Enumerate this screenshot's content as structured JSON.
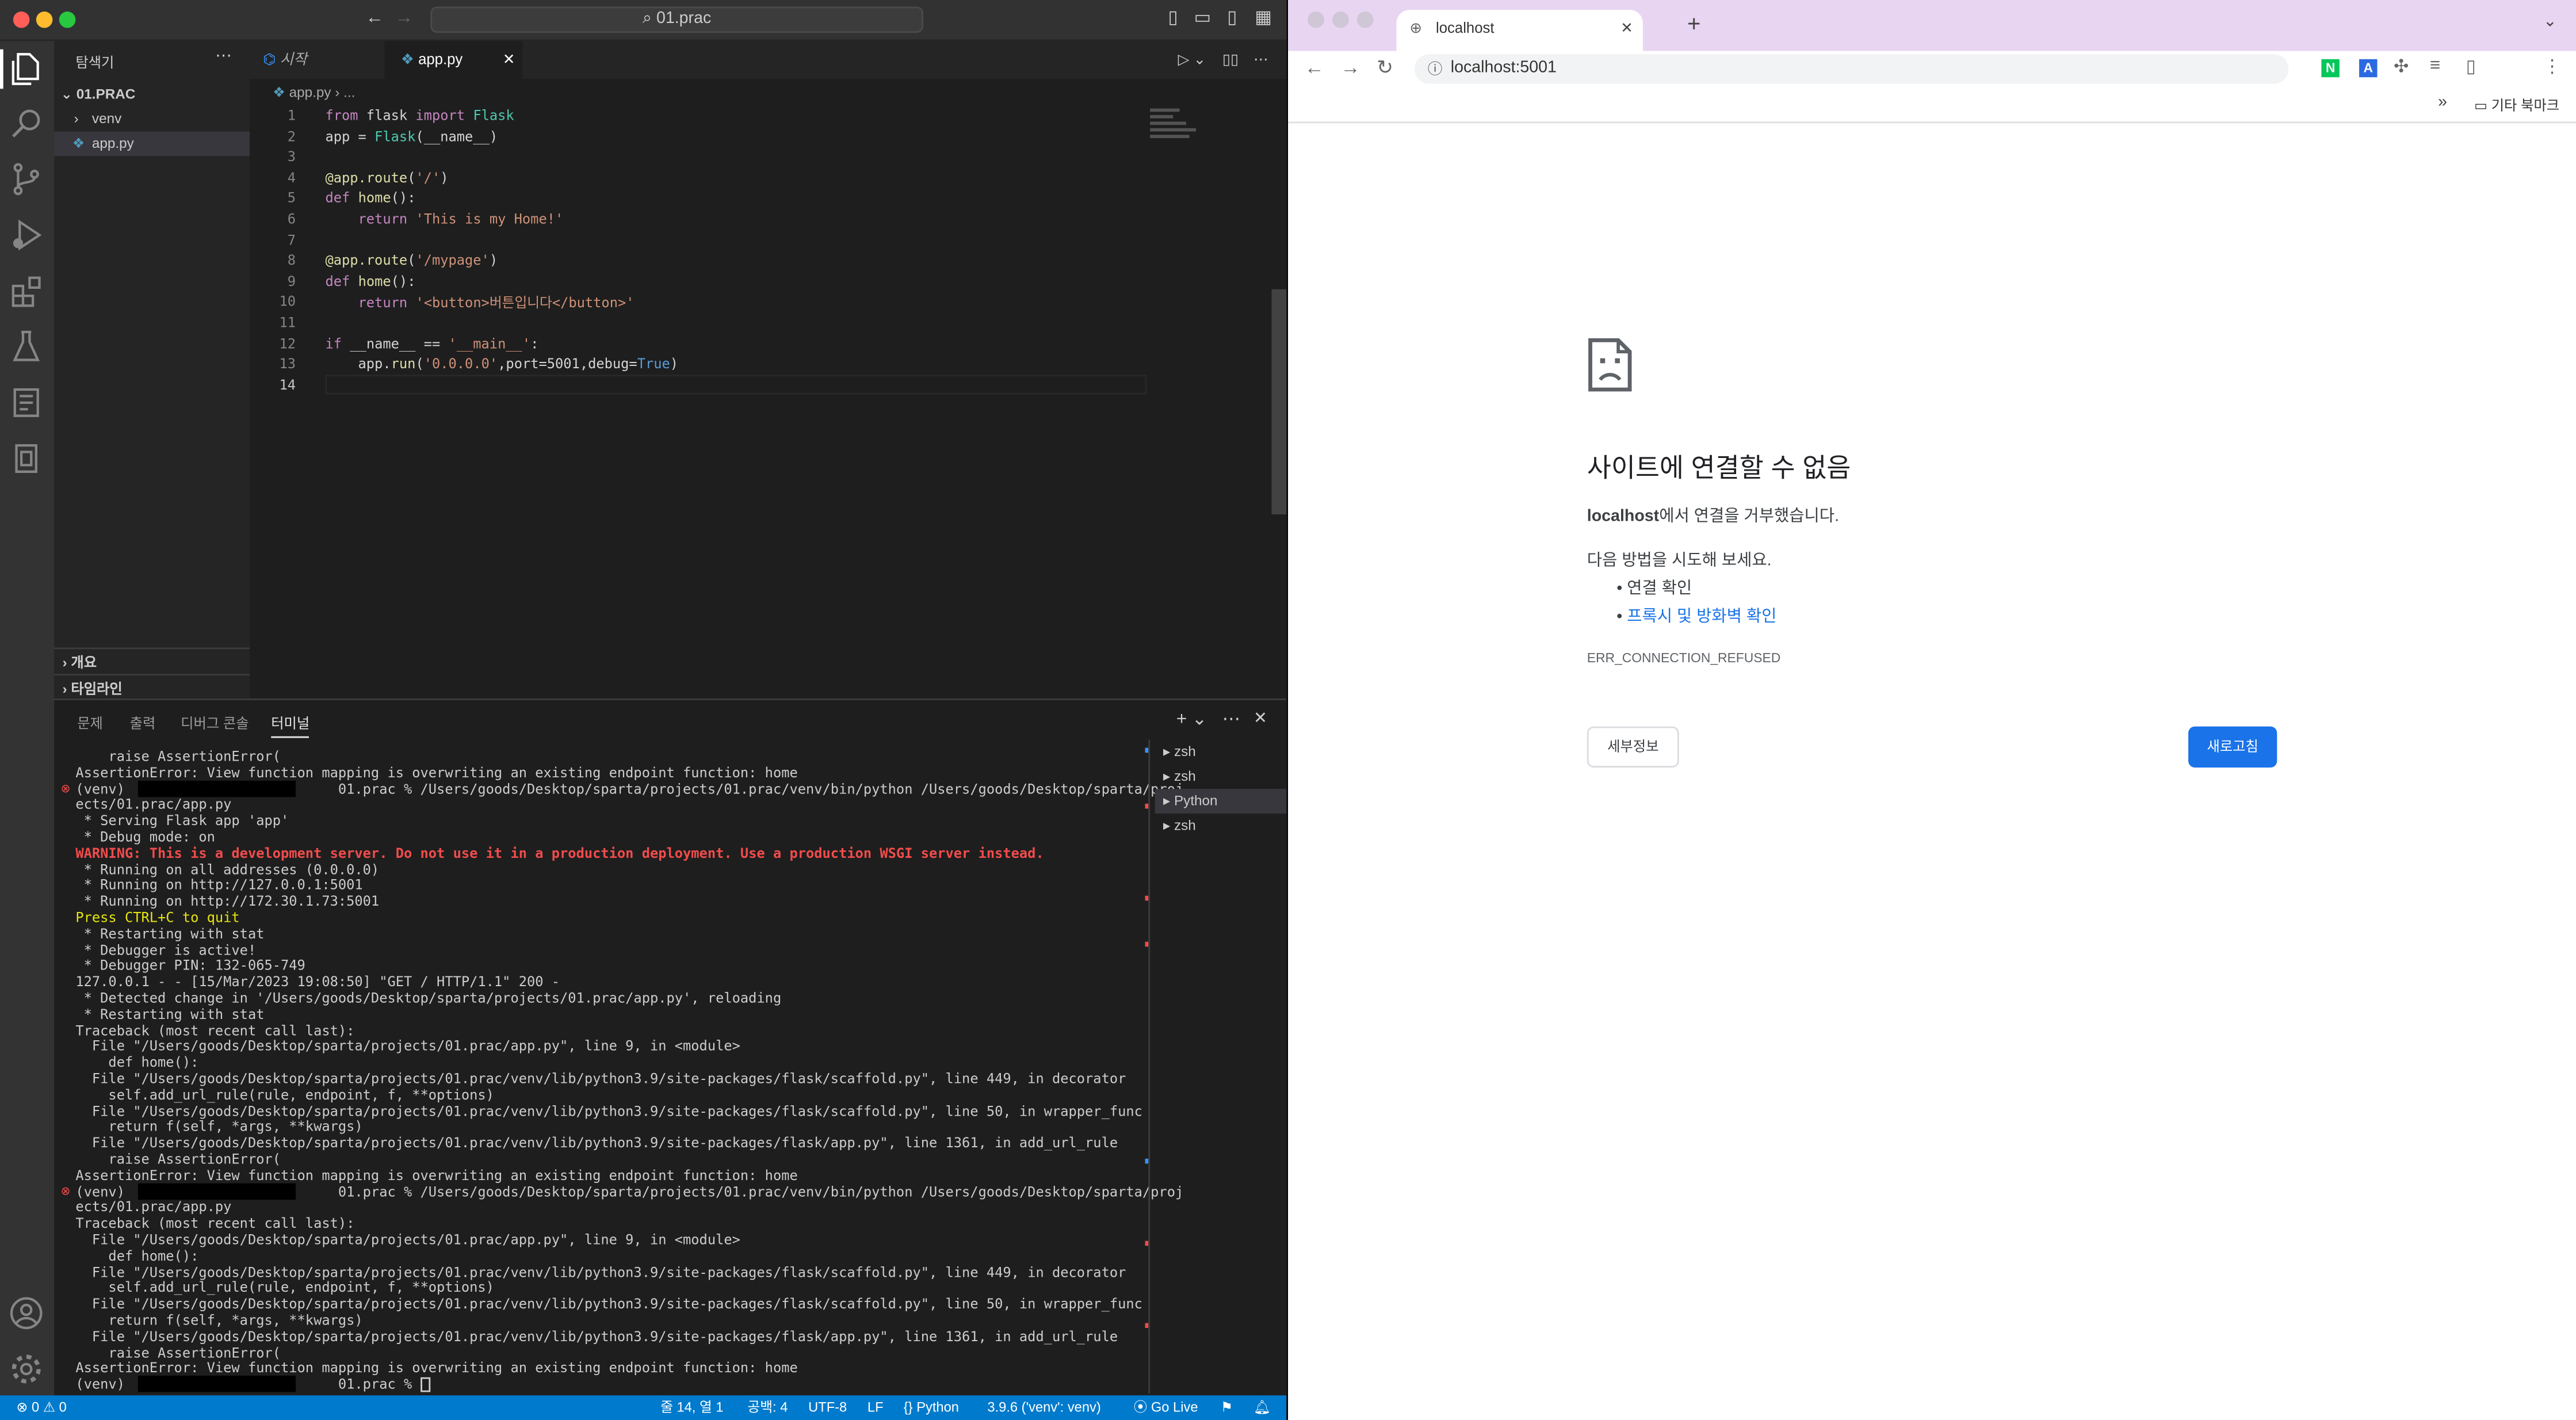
{
  "vscode": {
    "title_search": "01.prac",
    "explorer": {
      "title": "탐색기",
      "project": "01.PRAC",
      "items": [
        {
          "label": "venv",
          "type": "folder"
        },
        {
          "label": "app.py",
          "type": "file"
        }
      ],
      "outline_label": "개요",
      "timeline_label": "타임라인"
    },
    "tabs": [
      {
        "label": "시작"
      },
      {
        "label": "app.py"
      }
    ],
    "breadcrumb": [
      "app.py",
      "..."
    ],
    "code_lines": [
      "from flask import Flask",
      "app = Flask(__name__)",
      "",
      "@app.route('/')",
      "def home():",
      "    return 'This is my Home!'",
      "",
      "@app.route('/mypage')",
      "def home():",
      "    return '<button>버튼입니다</button>'",
      "",
      "if __name__ == '__main__':",
      "    app.run('0.0.0.0',port=5001,debug=True)",
      ""
    ],
    "panel_tabs": [
      "문제",
      "출력",
      "디버그 콘솔",
      "터미널"
    ],
    "terminal_lines": [
      "    raise AssertionError(",
      "AssertionError: View function mapping is overwriting an existing endpoint function: home",
      "(venv)                          01.prac % /Users/goods/Desktop/sparta/projects/01.prac/venv/bin/python /Users/goods/Desktop/sparta/proj",
      "ects/01.prac/app.py",
      " * Serving Flask app 'app'",
      " * Debug mode: on",
      "WARNING: This is a development server. Do not use it in a production deployment. Use a production WSGI server instead.",
      " * Running on all addresses (0.0.0.0)",
      " * Running on http://127.0.0.1:5001",
      " * Running on http://172.30.1.73:5001",
      "Press CTRL+C to quit",
      " * Restarting with stat",
      " * Debugger is active!",
      " * Debugger PIN: 132-065-749",
      "127.0.0.1 - - [15/Mar/2023 19:08:50] \"GET / HTTP/1.1\" 200 -",
      " * Detected change in '/Users/goods/Desktop/sparta/projects/01.prac/app.py', reloading",
      " * Restarting with stat",
      "Traceback (most recent call last):",
      "  File \"/Users/goods/Desktop/sparta/projects/01.prac/app.py\", line 9, in <module>",
      "    def home():",
      "  File \"/Users/goods/Desktop/sparta/projects/01.prac/venv/lib/python3.9/site-packages/flask/scaffold.py\", line 449, in decorator",
      "    self.add_url_rule(rule, endpoint, f, **options)",
      "  File \"/Users/goods/Desktop/sparta/projects/01.prac/venv/lib/python3.9/site-packages/flask/scaffold.py\", line 50, in wrapper_func",
      "    return f(self, *args, **kwargs)",
      "  File \"/Users/goods/Desktop/sparta/projects/01.prac/venv/lib/python3.9/site-packages/flask/app.py\", line 1361, in add_url_rule",
      "    raise AssertionError(",
      "AssertionError: View function mapping is overwriting an existing endpoint function: home",
      "(venv)                          01.prac % /Users/goods/Desktop/sparta/projects/01.prac/venv/bin/python /Users/goods/Desktop/sparta/proj",
      "ects/01.prac/app.py",
      "Traceback (most recent call last):",
      "  File \"/Users/goods/Desktop/sparta/projects/01.prac/app.py\", line 9, in <module>",
      "    def home():",
      "  File \"/Users/goods/Desktop/sparta/projects/01.prac/venv/lib/python3.9/site-packages/flask/scaffold.py\", line 449, in decorator",
      "    self.add_url_rule(rule, endpoint, f, **options)",
      "  File \"/Users/goods/Desktop/sparta/projects/01.prac/venv/lib/python3.9/site-packages/flask/scaffold.py\", line 50, in wrapper_func",
      "    return f(self, *args, **kwargs)",
      "  File \"/Users/goods/Desktop/sparta/projects/01.prac/venv/lib/python3.9/site-packages/flask/app.py\", line 1361, in add_url_rule",
      "    raise AssertionError(",
      "AssertionError: View function mapping is overwriting an existing endpoint function: home",
      "(venv)                          01.prac % "
    ],
    "terminal_list": [
      "zsh",
      "zsh",
      "Python",
      "zsh"
    ],
    "status": {
      "errors": "0",
      "warnings": "0",
      "cursor": "줄 14, 열 1",
      "spaces": "공백: 4",
      "encoding": "UTF-8",
      "eol": "LF",
      "language": "Python",
      "interpreter": "3.9.6 ('venv': venv)",
      "golive": "Go Live"
    },
    "colors": {
      "status_bar": "#007acc",
      "warning_text": "#f14c4c"
    }
  },
  "chrome": {
    "tab_title": "localhost",
    "url": "localhost:5001",
    "bookmarks_label": "기타 북마크",
    "error": {
      "heading": "사이트에 연결할 수 없음",
      "host": "localhost",
      "desc_suffix": "에서 연결을 거부했습니다.",
      "try_label": "다음 방법을 시도해 보세요.",
      "suggestion_1": "연결 확인",
      "suggestion_2": "프록시 및 방화벽 확인",
      "code": "ERR_CONNECTION_REFUSED",
      "details_button": "세부정보",
      "reload_button": "새로고침"
    },
    "colors": {
      "tabbar": "#e8d5f2",
      "primary": "#1a73e8"
    }
  }
}
